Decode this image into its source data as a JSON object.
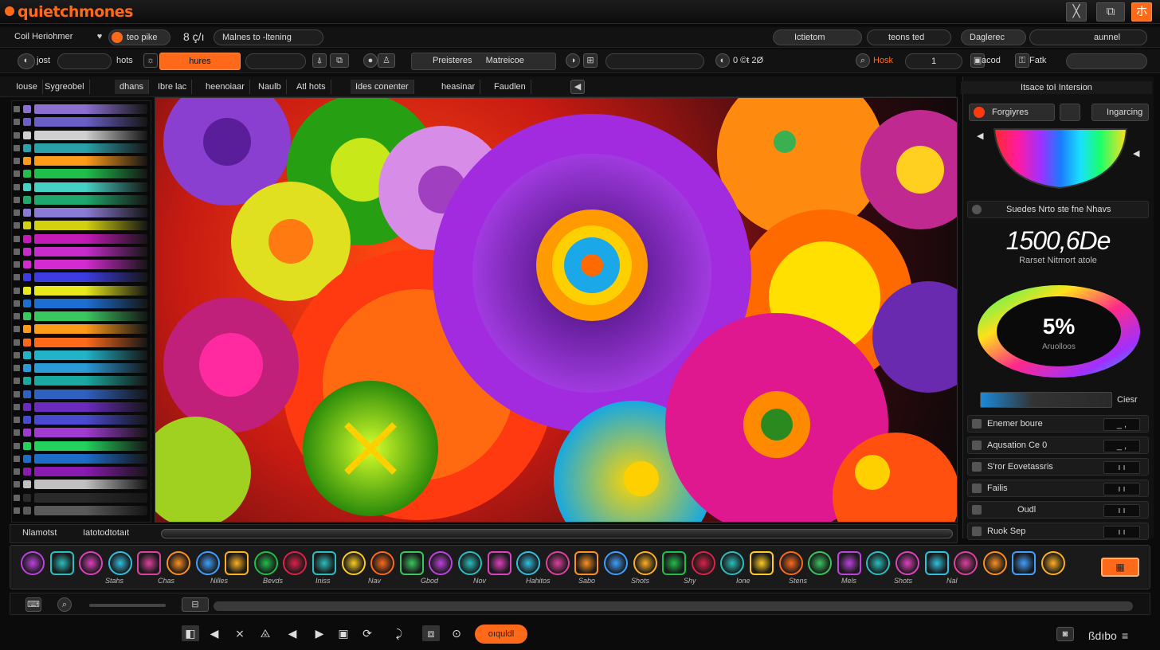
{
  "app": {
    "title": "quietchmones",
    "accent": "#ff6a1a"
  },
  "titlebar": {
    "win_buttons": [
      "╳",
      "⧉",
      "ホ"
    ]
  },
  "toolbar1": {
    "doc_label": "Coil Heriohmer",
    "search_chip": "teo pike",
    "count": "8 ç/ı",
    "mode_field": "Malnes to -ltening",
    "right_dropdown": "Ictietom",
    "right_field": "teons ted",
    "right_select": "Daglerec",
    "right_select2": "aunnel"
  },
  "toolbar2": {
    "root_label": "jost",
    "hots_label": "hots",
    "hues_button": "hures",
    "preset_label": "Preisteres",
    "material_label": "Matreicoe",
    "zoom_value": "0 ©ŧ 2Ø",
    "hosk_label": "Hosk",
    "hosk_value": "1",
    "end_label": "acod",
    "end_label2": "Fatk"
  },
  "tabs": [
    "Iouse",
    "Sygreobel",
    "dhans",
    "Ibre lac",
    "heenoiaar",
    "Naulb",
    "Atl hots",
    "Ides conenter",
    "heasinar",
    "Faudlen"
  ],
  "left_panel": {
    "swatch_colors": [
      "#8b6fd1",
      "#6a5fc7",
      "#d0d0d0",
      "#2aa1a8",
      "#ff9b1a",
      "#1fbf4a",
      "#45d1c4",
      "#1ea86b",
      "#8a7bd4",
      "#d3d10f",
      "#c41ab8",
      "#c82bcc",
      "#d42ad1",
      "#3c3ce0",
      "#e8e81a",
      "#1c6fd1",
      "#39c760",
      "#ff9b1a",
      "#ff6a1a",
      "#21b3c7",
      "#2a9ad9",
      "#19a9a0",
      "#3060c0",
      "#6b2bbf",
      "#4a4ad0",
      "#a03ad0",
      "#23d15c",
      "#1c6cc8",
      "#8a1ab0",
      "#c0c0c0",
      "#2a2a2a",
      "#5a5a5a"
    ]
  },
  "right_panel": {
    "header": "Itsace toI Intersion",
    "tabs": [
      "Forgiyres",
      "Ingarcing"
    ],
    "section_title": "Suedes  Nrto ste  fne  Nhavs",
    "big_value": "1500,6De",
    "big_caption": "Rarset Nitmort atole",
    "ring_value": "5%",
    "ring_caption": "Aruolloos",
    "slider_label": "Ciesr",
    "rows": [
      {
        "label": "Enemer boure",
        "value": "_ ,"
      },
      {
        "label": "Aqusation Ce 0",
        "value": "_ ,"
      },
      {
        "label": "S'ror Eovetassris",
        "value": "ı ı"
      },
      {
        "label": "Failis",
        "value": "ı ı"
      },
      {
        "label": "Oudl",
        "value": "ı ı"
      },
      {
        "label": "Ruok   Sep",
        "value": "ı ı"
      }
    ]
  },
  "statusbar": {
    "left": "Nlamotst",
    "mid": "Iatotodtotaıt"
  },
  "tools": {
    "labels": [
      "Stahs",
      "Chas",
      "Nilles",
      "Bevds",
      "Iniss",
      "Nav",
      "Gbod",
      "Nov",
      "Hahitos",
      "Sabo",
      "Shots",
      "Shy",
      "Ione",
      "Stens",
      "Mels",
      "Shots",
      "Nal"
    ],
    "colors": [
      "#c040e0",
      "#2ac0c0",
      "#e040c0",
      "#30c0e0",
      "#e040a0",
      "#ff9020",
      "#40a0ff",
      "#ffb020",
      "#1fbf4a",
      "#e0204a",
      "#2ac0c0",
      "#ffcc20",
      "#ff6a1a",
      "#39c760"
    ]
  },
  "bottom": {
    "nav_icons": [
      "◧",
      "◀",
      "⨯",
      "⨻",
      "◀",
      "▶",
      "▣",
      "⟳",
      "⤸",
      "⧈",
      "⊙"
    ],
    "upload_button": "oıquldl",
    "zoom_text": "ßdıbo"
  }
}
